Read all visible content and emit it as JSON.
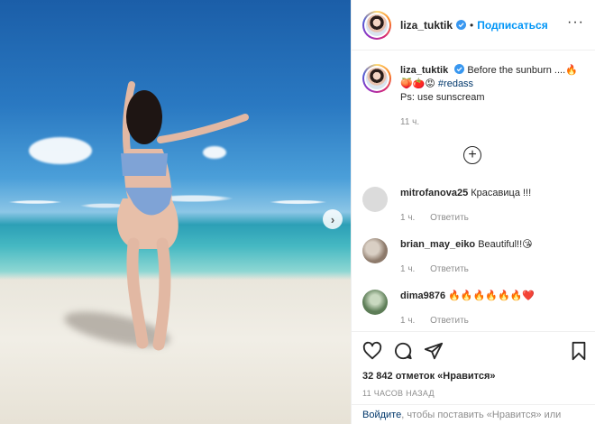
{
  "post": {
    "next_arrow": "›"
  },
  "header": {
    "username": "liza_tuktik",
    "dot": "•",
    "follow_label": "Подписаться",
    "more": "···"
  },
  "caption": {
    "username": "liza_tuktik",
    "text_line1": "Before the sunburn ....🔥",
    "emojis": "🍑🍅😡 ",
    "hashtag": "#redass",
    "text_line2": "Ps: use sunscream",
    "time": "11 ч."
  },
  "load_more": "+",
  "comments": [
    {
      "username": "mitrofanova25",
      "text": "Красавица !!!",
      "time": "1 ч.",
      "reply": "Ответить",
      "avatar_color": "#dbdbdb"
    },
    {
      "username": "brian_may_eiko",
      "text": "Beautiful!!😘",
      "time": "1 ч.",
      "reply": "Ответить",
      "avatar_color": "#b9a89a"
    },
    {
      "username": "dima9876",
      "text": "🔥🔥🔥🔥🔥🔥❤️",
      "time": "1 ч.",
      "reply": "Ответить",
      "avatar_color": "#6f8f6a"
    }
  ],
  "actions": {
    "like_icon": "heart-icon",
    "comment_icon": "comment-icon",
    "share_icon": "share-icon",
    "save_icon": "bookmark-icon"
  },
  "likes": {
    "count": "32 842",
    "text": "отметок «Нравится»"
  },
  "time_ago": "11 часов назад",
  "login_bar": {
    "link": "Войдите",
    "text": ", чтобы поставить «Нравится» или"
  },
  "colors": {
    "accent": "#0095f6",
    "verified": "#3897f0",
    "text": "#262626",
    "muted": "#8e8e8e"
  }
}
